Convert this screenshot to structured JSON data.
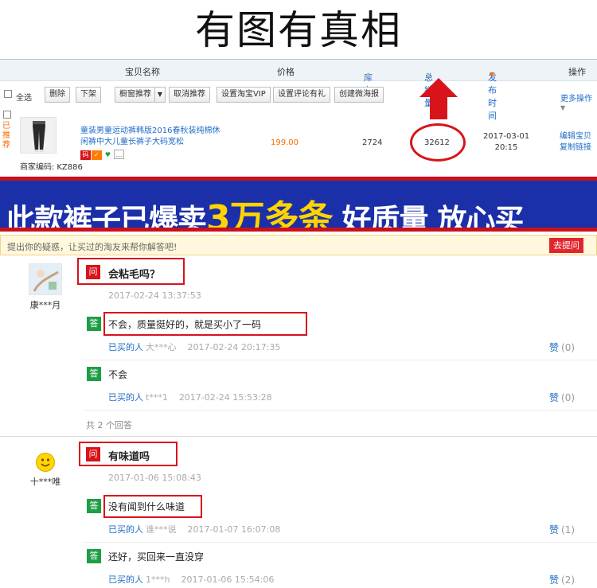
{
  "hero_title": "有图有真相",
  "seller": {
    "columns": {
      "name": "宝贝名称",
      "price": "价格",
      "stock": "库存",
      "sales": "总销量",
      "publish_time": "发布时间",
      "action": "操作"
    },
    "toolbar": {
      "select_all": "全选",
      "buttons": [
        "删除",
        "下架",
        "橱窗推荐",
        "取消推荐",
        "设置淘宝VIP",
        "设置评论有礼",
        "创建微海报"
      ],
      "more": "更多操作"
    },
    "item": {
      "recommended_tag": "已推荐",
      "title": "童装男童运动裤韩版2016春秋装纯棉休闲裤中大儿童长裤子大码宽松",
      "merchant_label": "商家编码:",
      "merchant_code": "KZ886",
      "price": "199.00",
      "stock": "2724",
      "sales": "32612",
      "date": "2017-03-01",
      "time": "20:15",
      "ops": [
        "编辑宝贝",
        "复制链接"
      ],
      "badges": [
        "码",
        "✓",
        "♥",
        "…"
      ]
    }
  },
  "banner": {
    "part1": "此款裤子已爆卖",
    "emph": "3万多条",
    "part2": " 好质量 放心买"
  },
  "qa": {
    "prompt": "提出你的疑惑，让买过的淘友来帮你解答吧!",
    "ask_button": "去提问",
    "q_tag": "问",
    "a_tag": "答",
    "buyer_label": "已买的人",
    "like_label": "赞",
    "threads": [
      {
        "user": "康***月",
        "question": "会粘毛吗？",
        "question_time": "2017-02-24 13:37:53",
        "answers": [
          {
            "text": "不会，质量挺好的，就是买小了一码",
            "buyer": "大***心",
            "time": "2017-02-24 20:17:35",
            "likes": "(0)"
          },
          {
            "text": "不会",
            "buyer": "t***1",
            "time": "2017-02-24 15:53:28",
            "likes": "(0)"
          }
        ],
        "count": "共 2 个回答"
      },
      {
        "user": "十***唯",
        "question": "有味道吗",
        "question_time": "2017-01-06 15:08:43",
        "answers": [
          {
            "text": "没有闻到什么味道",
            "buyer": "谁***说",
            "time": "2017-01-07 16:07:08",
            "likes": "(1)"
          },
          {
            "text": "还好，买回来一直没穿",
            "buyer": "1***h",
            "time": "2017-01-06 15:54:06",
            "likes": "(2)"
          }
        ]
      }
    ]
  }
}
